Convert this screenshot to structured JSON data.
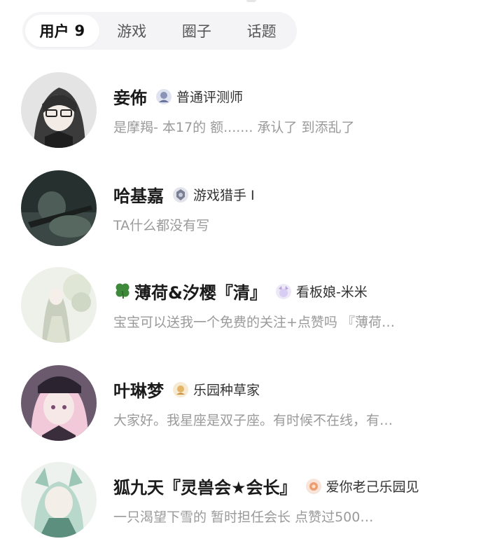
{
  "tabs": [
    {
      "label": "用户",
      "count": "9",
      "active": true
    },
    {
      "label": "游戏"
    },
    {
      "label": "圈子"
    },
    {
      "label": "话题"
    }
  ],
  "users": [
    {
      "name": "妾佈",
      "badge_icon": "reviewer-badge-icon",
      "badge": "普通评测师",
      "bio": "是摩羯- 本17的 额....... 承认了 到添乱了",
      "avatar_colors": [
        "#d8d8d8",
        "#3a3a3a"
      ]
    },
    {
      "name": "哈基嘉",
      "badge_icon": "hunter-badge-icon",
      "badge": "游戏猎手 I",
      "bio": "TA什么都没有写",
      "avatar_colors": [
        "#2d3b3a",
        "#56685f"
      ]
    },
    {
      "name": "薄荷&汐樱『清』",
      "name_prefix_icon": "clover-icon",
      "badge_icon": "mascot-badge-icon",
      "badge": "看板娘-米米",
      "bio": "宝宝可以送我一个免费的关注+点赞吗 『薄荷…",
      "avatar_colors": [
        "#e9ece4",
        "#b9c3ae"
      ]
    },
    {
      "name": "叶琳梦",
      "badge_icon": "gardener-badge-icon",
      "badge": "乐园种草家",
      "bio": "大家好。我星座是双子座。有时候不在线，有…",
      "avatar_colors": [
        "#5a4f6a",
        "#f0c8d6"
      ]
    },
    {
      "name": "狐九天『灵兽会★会长』",
      "badge_icon": "paradise-badge-icon",
      "badge": "爱你老己乐园见",
      "bio": "一只渴望下雪的    暂时担任会长  点赞过500…",
      "avatar_colors": [
        "#eef1ee",
        "#8fb9a8"
      ]
    }
  ]
}
